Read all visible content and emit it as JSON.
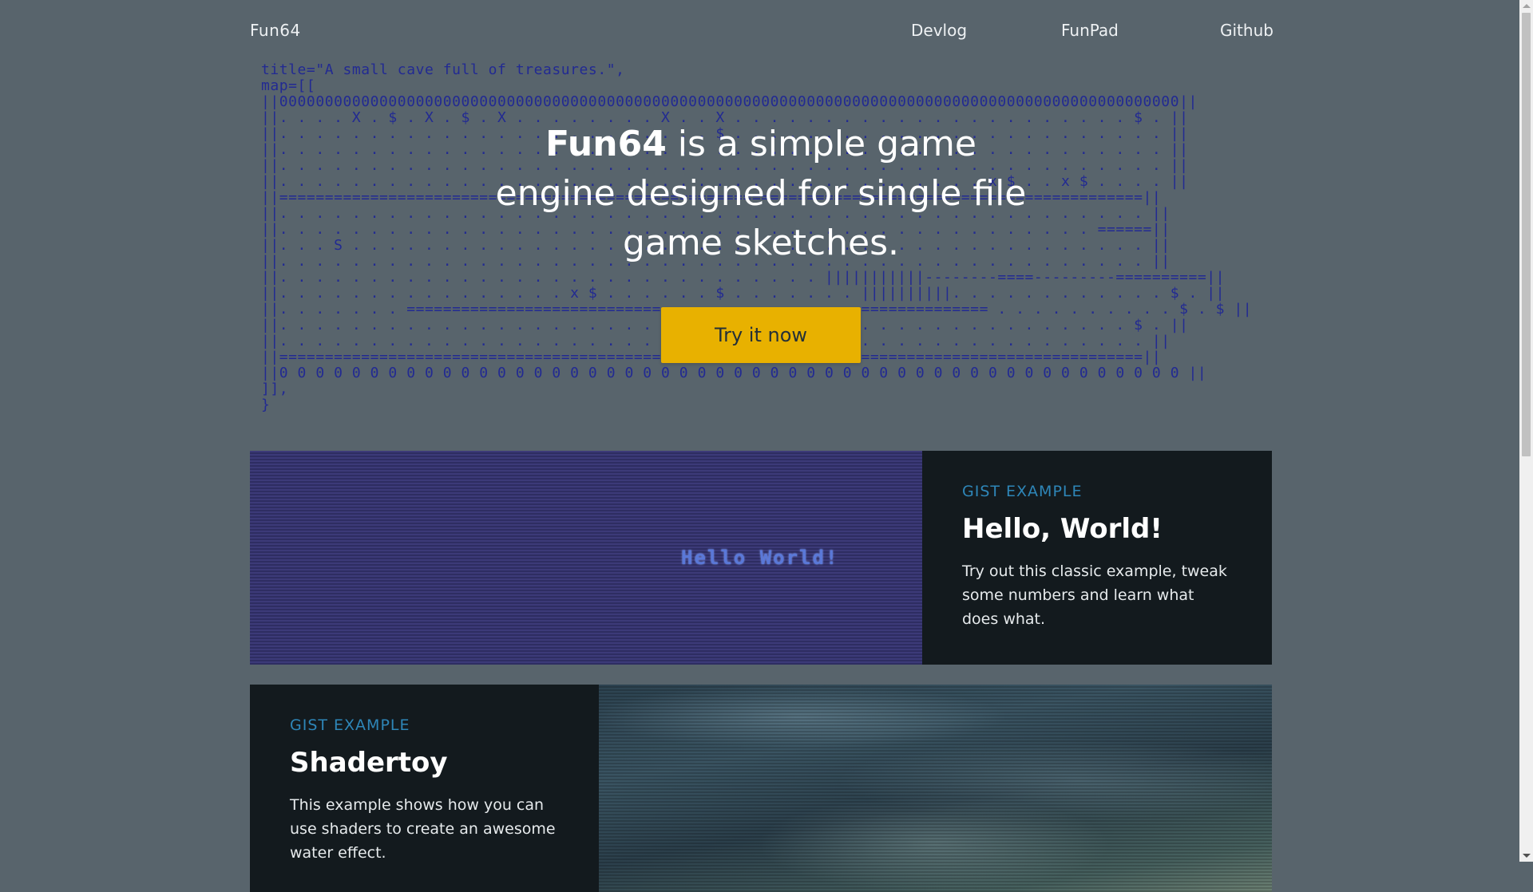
{
  "nav": {
    "brand": "Fun64",
    "links": [
      "Devlog",
      "FunPad",
      "Github"
    ]
  },
  "hero": {
    "code_lines": [
      "title=\"A small cave full of treasures.\",",
      "map=[[",
      "||000000000000000000000000000000000000000000000000000000000000000000000000000000000000000000000000000||",
      "||. . . . X . $ . X . $ . X . . . . . . . . X . . X . . . . . . . . . . . . . . . . . . . . . . $ . ||",
      "||. . . . . . . . . . . . . . . . . . . . . . . . $ . . . . . . . . . . . . . . . . . . . . . . . . ||",
      "||. . . . . . . . . . . . . . . . . . . . . . . . . . . . . . . . . . . . . . . . . . . . . . . . . ||",
      "||. . . . . . . . . . . . . . . . . . . . . . . . . . . . . . . . . . . . . . . . . . . . . . . . . ||",
      "||. . . . . . . . . . . . . . . . . . . . . . . . . . . . . . . . . . . . . . . x $ . . x $ . . . . ||",
      "||===============================================================================================||",
      "||. . . . . . . . . . . . . . . . . . . . . . . . . . . . . . . . . . . . . . . . . . . . . . . . ||",
      "||. . . . . . . . . . . . . . . . . . . . . . . . . . . . . . . . . . . . . . . . . . . . . ======||",
      "||. . . S . . . . . . . . . . . . . . . . . . . . . . . . . . . . . . . . . . . . . . . . . . . . ||",
      "||. . . . . . . . . . . . . . . . . . . . . . . . . . . . . . . . . . . . . . . . . . . . . . . . ||",
      "||. . . . . . . . . . . . . . . . . . . . . . . . . . . . . . |||||||||||--------====---------==========||",
      "||. . . . . . . . . . . . . . . . x $ . . . . . . $ . . . . . . . ||||||||||. . . . . . . . . . . . $ . ||",
      "||. . . . . . . ================================================================ . . . . . . . . . . $ . $ ||",
      "||. . . . . . . . . . . . . . . . . . . . . . . . . . . . . . . . . . . . . . . . . . . . . . . $ . ||",
      "||. . . . . . . . . . . . . . . . . . . . . . . . . . . . . . . . . . . . . . . . . . . . . . . . ||",
      "||===============================================================================================||",
      "||0 0 0 0 0 0 0 0 0 0 0 0 0 0 0 0 0 0 0 0 0 0 0 0 0 0 0 0 0 0 0 0 0 0 0 0 0 0 0 0 0 0 0 0 0 0 0 0 0 0 ||",
      "]],",
      "}"
    ],
    "title_bold": "Fun64",
    "title_rest": " is a simple game engine designed for single file game sketches.",
    "cta_label": "Try it now",
    "cta_color": "#e8b100"
  },
  "cards": [
    {
      "eyebrow": "GIST EXAMPLE",
      "title": "Hello, World!",
      "description": "Try out this classic example, tweak some numbers and learn what does what.",
      "preview_text": "Hello World!"
    },
    {
      "eyebrow": "GIST EXAMPLE",
      "title": "Shadertoy",
      "description": "This example shows how you can use shaders to create an awesome water effect."
    }
  ],
  "colors": {
    "page_background": "#58646c",
    "card_background": "#131a1e",
    "eyebrow": "#2e86b8",
    "code_text": "#222a92"
  }
}
